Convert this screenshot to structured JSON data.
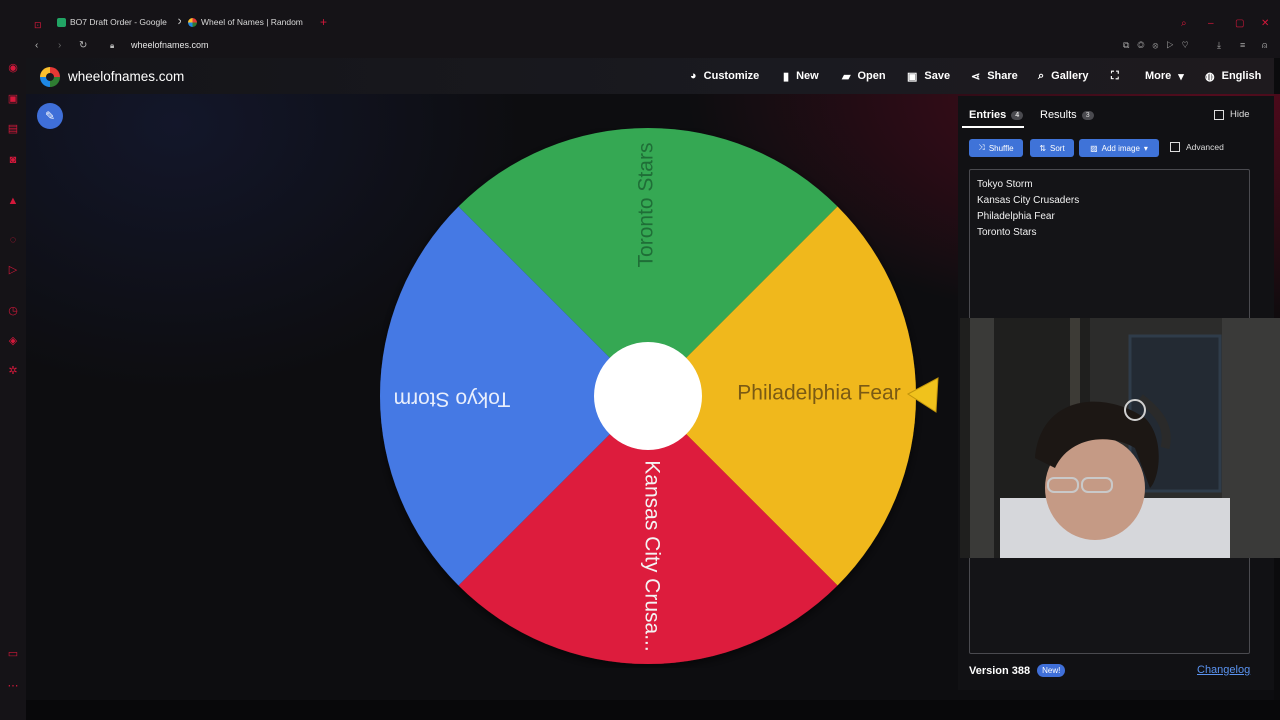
{
  "browser": {
    "tabs": [
      {
        "title": "BO7 Draft Order - Google"
      },
      {
        "title": "Wheel of Names | Random"
      }
    ],
    "new_tab": "+",
    "url": "wheelofnames.com"
  },
  "app": {
    "brand": "wheelofnames.com",
    "nav": [
      {
        "label": "Customize",
        "icon": "palette-icon"
      },
      {
        "label": "New",
        "icon": "file-icon"
      },
      {
        "label": "Open",
        "icon": "folder-icon"
      },
      {
        "label": "Save",
        "icon": "save-icon"
      },
      {
        "label": "Share",
        "icon": "share-icon"
      },
      {
        "label": "Gallery",
        "icon": "search-icon"
      },
      {
        "label": "More",
        "icon": "chevron-down-icon"
      },
      {
        "label": "English",
        "icon": "globe-icon"
      }
    ]
  },
  "wheel": {
    "segments": [
      {
        "label": "Toronto Stars",
        "color": "#34a853"
      },
      {
        "label": "Philadelphia Fear",
        "color": "#f0b81c"
      },
      {
        "label": "Kansas City Crusa...",
        "color": "#dd1d3c"
      },
      {
        "label": "Tokyo Storm",
        "color": "#4479e4"
      }
    ]
  },
  "panel": {
    "tabs": [
      {
        "label": "Entries",
        "count": "4"
      },
      {
        "label": "Results",
        "count": "3"
      }
    ],
    "hide_label": "Hide",
    "buttons": {
      "shuffle": "Shuffle",
      "sort": "Sort",
      "add_image": "Add image"
    },
    "advanced_label": "Advanced",
    "entries": [
      "Tokyo Storm",
      "Kansas City Crusaders",
      "Philadelphia Fear",
      "Toronto Stars"
    ],
    "version": "Version 388",
    "new_badge": "New!",
    "changelog": "Changelog"
  }
}
